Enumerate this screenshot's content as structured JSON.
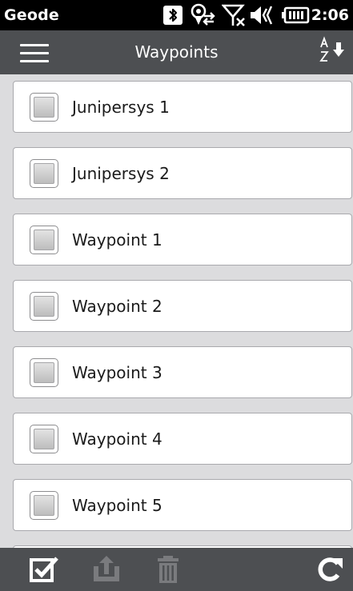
{
  "statusbar": {
    "app_name": "Geode",
    "time": "2:06",
    "icons": [
      "bluetooth-icon",
      "gps-sync-icon",
      "no-signal-icon",
      "volume-icon",
      "battery-icon"
    ]
  },
  "header": {
    "title": "Waypoints",
    "menu_icon": "hamburger-menu-icon",
    "sort_icon": "sort-az-icon"
  },
  "waypoints": [
    {
      "label": "Junipersys 1",
      "checked": false
    },
    {
      "label": "Junipersys 2",
      "checked": false
    },
    {
      "label": "Waypoint 1",
      "checked": false
    },
    {
      "label": "Waypoint 2",
      "checked": false
    },
    {
      "label": "Waypoint 3",
      "checked": false
    },
    {
      "label": "Waypoint 4",
      "checked": false
    },
    {
      "label": "Waypoint 5",
      "checked": false
    }
  ],
  "toolbar": {
    "select_icon": "select-all-icon",
    "export_icon": "export-icon",
    "delete_icon": "trash-icon",
    "refresh_icon": "refresh-icon"
  },
  "colors": {
    "statusbar_bg": "#000000",
    "header_bg": "#4d4f52",
    "list_bg": "#dcdcde",
    "item_bg": "#ffffff",
    "disabled_icon": "#7a7b7e"
  }
}
